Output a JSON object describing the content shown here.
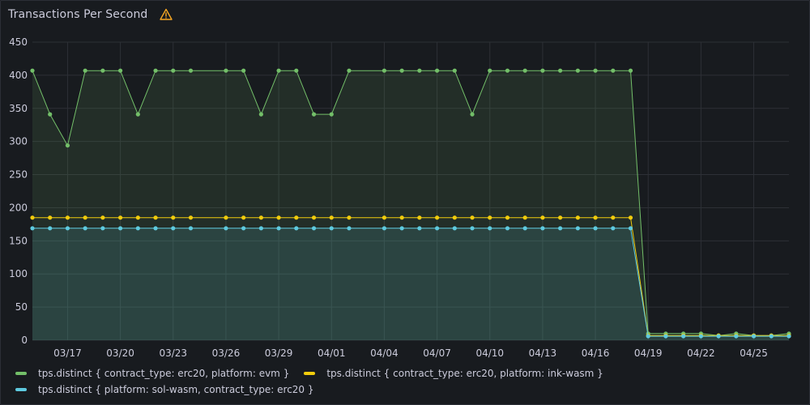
{
  "panel": {
    "title": "Transactions Per Second",
    "warning_icon": "warning-triangle-icon",
    "warning_color": "#f5a623"
  },
  "chart_data": {
    "type": "line",
    "title": "Transactions Per Second",
    "xlabel": "",
    "ylabel": "",
    "ylim": [
      0,
      450
    ],
    "yticks": [
      0,
      50,
      100,
      150,
      200,
      250,
      300,
      350,
      400,
      450
    ],
    "xlim": [
      "03/15",
      "04/27"
    ],
    "xticks": [
      "03/17",
      "03/20",
      "03/23",
      "03/26",
      "03/29",
      "04/01",
      "04/04",
      "04/07",
      "04/10",
      "04/13",
      "04/16",
      "04/19",
      "04/22",
      "04/25"
    ],
    "grid": true,
    "legend_position": "bottom",
    "series": [
      {
        "name": "tps.distinct { contract_type: erc20, platform: evm }",
        "color": "#73bf69",
        "fill": "rgba(115,191,105,0.12)",
        "points": [
          [
            "03/15",
            407
          ],
          [
            "03/16",
            341
          ],
          [
            "03/17",
            294
          ],
          [
            "03/18",
            407
          ],
          [
            "03/19",
            407
          ],
          [
            "03/20",
            407
          ],
          [
            "03/21",
            341
          ],
          [
            "03/22",
            407
          ],
          [
            "03/23",
            407
          ],
          [
            "03/24",
            407
          ],
          [
            "03/26",
            407
          ],
          [
            "03/27",
            407
          ],
          [
            "03/28",
            341
          ],
          [
            "03/29",
            407
          ],
          [
            "03/30",
            407
          ],
          [
            "03/31",
            341
          ],
          [
            "04/01",
            341
          ],
          [
            "04/02",
            407
          ],
          [
            "04/04",
            407
          ],
          [
            "04/05",
            407
          ],
          [
            "04/06",
            407
          ],
          [
            "04/07",
            407
          ],
          [
            "04/08",
            407
          ],
          [
            "04/09",
            341
          ],
          [
            "04/10",
            407
          ],
          [
            "04/11",
            407
          ],
          [
            "04/12",
            407
          ],
          [
            "04/13",
            407
          ],
          [
            "04/14",
            407
          ],
          [
            "04/15",
            407
          ],
          [
            "04/16",
            407
          ],
          [
            "04/17",
            407
          ],
          [
            "04/18",
            407
          ],
          [
            "04/19",
            10
          ],
          [
            "04/20",
            10
          ],
          [
            "04/21",
            10
          ],
          [
            "04/22",
            10
          ],
          [
            "04/23",
            7
          ],
          [
            "04/24",
            10
          ],
          [
            "04/25",
            7
          ],
          [
            "04/26",
            7
          ],
          [
            "04/27",
            10
          ]
        ]
      },
      {
        "name": "tps.distinct { contract_type: erc20, platform: ink-wasm }",
        "color": "#f2cc0c",
        "fill": "rgba(242,204,12,0.0)",
        "points": [
          [
            "03/15",
            185
          ],
          [
            "03/16",
            185
          ],
          [
            "03/17",
            185
          ],
          [
            "03/18",
            185
          ],
          [
            "03/19",
            185
          ],
          [
            "03/20",
            185
          ],
          [
            "03/21",
            185
          ],
          [
            "03/22",
            185
          ],
          [
            "03/23",
            185
          ],
          [
            "03/24",
            185
          ],
          [
            "03/26",
            185
          ],
          [
            "03/27",
            185
          ],
          [
            "03/28",
            185
          ],
          [
            "03/29",
            185
          ],
          [
            "03/30",
            185
          ],
          [
            "03/31",
            185
          ],
          [
            "04/01",
            185
          ],
          [
            "04/02",
            185
          ],
          [
            "04/04",
            185
          ],
          [
            "04/05",
            185
          ],
          [
            "04/06",
            185
          ],
          [
            "04/07",
            185
          ],
          [
            "04/08",
            185
          ],
          [
            "04/09",
            185
          ],
          [
            "04/10",
            185
          ],
          [
            "04/11",
            185
          ],
          [
            "04/12",
            185
          ],
          [
            "04/13",
            185
          ],
          [
            "04/14",
            185
          ],
          [
            "04/15",
            185
          ],
          [
            "04/16",
            185
          ],
          [
            "04/17",
            185
          ],
          [
            "04/18",
            185
          ],
          [
            "04/19",
            7
          ],
          [
            "04/20",
            7
          ],
          [
            "04/21",
            7
          ],
          [
            "04/22",
            7
          ],
          [
            "04/23",
            7
          ],
          [
            "04/24",
            7
          ],
          [
            "04/25",
            7
          ],
          [
            "04/26",
            7
          ],
          [
            "04/27",
            7
          ]
        ]
      },
      {
        "name": "tps.distinct { platform: sol-wasm, contract_type: erc20 }",
        "color": "#5ecadf",
        "fill": "rgba(94,202,223,0.14)",
        "points": [
          [
            "03/15",
            169
          ],
          [
            "03/16",
            169
          ],
          [
            "03/17",
            169
          ],
          [
            "03/18",
            169
          ],
          [
            "03/19",
            169
          ],
          [
            "03/20",
            169
          ],
          [
            "03/21",
            169
          ],
          [
            "03/22",
            169
          ],
          [
            "03/23",
            169
          ],
          [
            "03/24",
            169
          ],
          [
            "03/26",
            169
          ],
          [
            "03/27",
            169
          ],
          [
            "03/28",
            169
          ],
          [
            "03/29",
            169
          ],
          [
            "03/30",
            169
          ],
          [
            "03/31",
            169
          ],
          [
            "04/01",
            169
          ],
          [
            "04/02",
            169
          ],
          [
            "04/04",
            169
          ],
          [
            "04/05",
            169
          ],
          [
            "04/06",
            169
          ],
          [
            "04/07",
            169
          ],
          [
            "04/08",
            169
          ],
          [
            "04/09",
            169
          ],
          [
            "04/10",
            169
          ],
          [
            "04/11",
            169
          ],
          [
            "04/12",
            169
          ],
          [
            "04/13",
            169
          ],
          [
            "04/14",
            169
          ],
          [
            "04/15",
            169
          ],
          [
            "04/16",
            169
          ],
          [
            "04/17",
            169
          ],
          [
            "04/18",
            169
          ],
          [
            "04/19",
            6
          ],
          [
            "04/20",
            6
          ],
          [
            "04/21",
            6
          ],
          [
            "04/22",
            6
          ],
          [
            "04/23",
            6
          ],
          [
            "04/24",
            6
          ],
          [
            "04/25",
            6
          ],
          [
            "04/26",
            6
          ],
          [
            "04/27",
            6
          ]
        ]
      }
    ]
  },
  "legend": {
    "row1": [
      {
        "label": "tps.distinct { contract_type: erc20, platform: evm }",
        "color": "#73bf69"
      },
      {
        "label": "tps.distinct { contract_type: erc20, platform: ink-wasm }",
        "color": "#f2cc0c"
      }
    ],
    "row2": [
      {
        "label": "tps.distinct { platform: sol-wasm, contract_type: erc20 }",
        "color": "#5ecadf"
      }
    ]
  }
}
